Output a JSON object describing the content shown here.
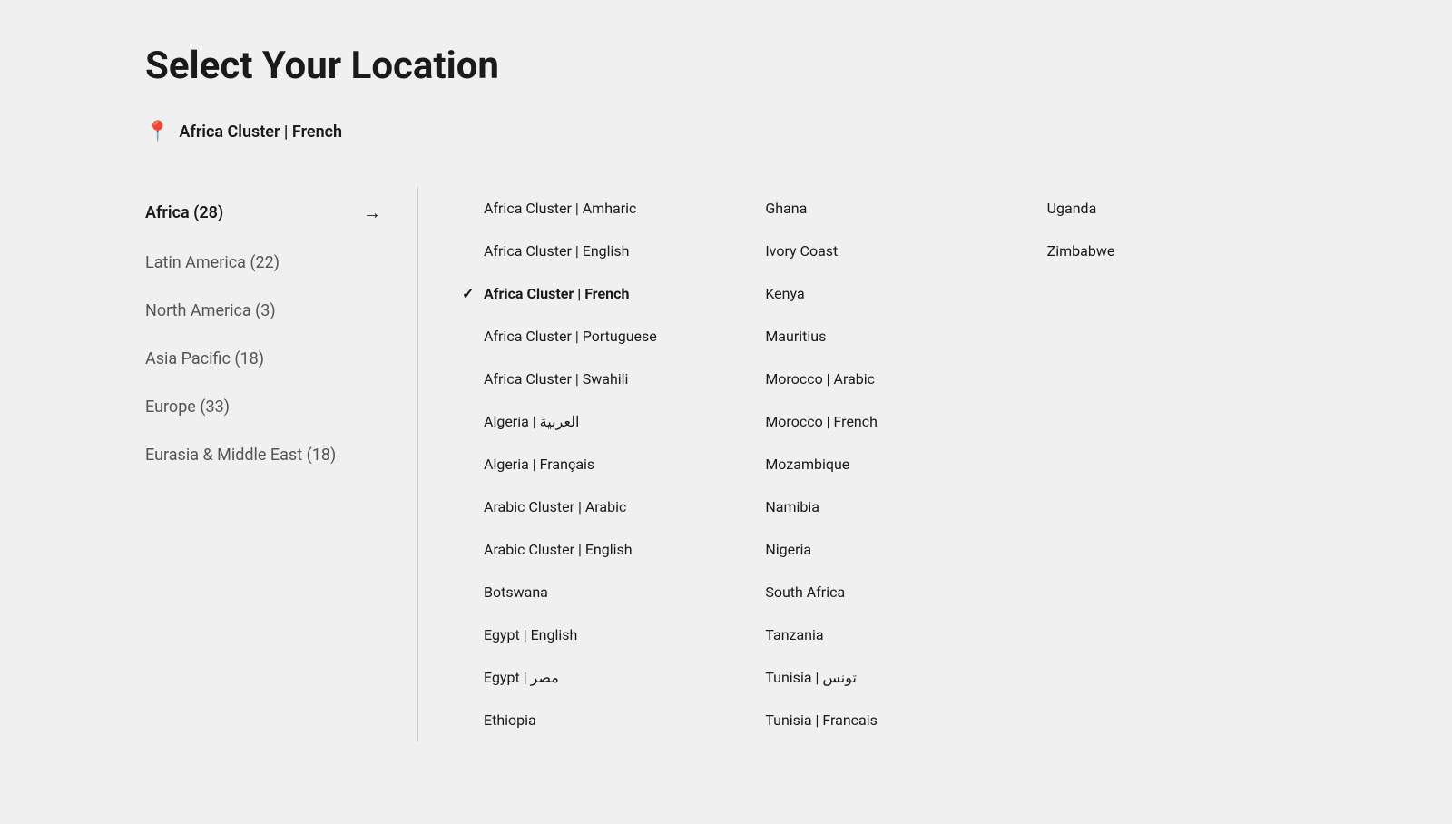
{
  "page": {
    "title": "Select Your Location",
    "current_location": "Africa Cluster | French",
    "location_icon": "📍"
  },
  "sidebar": {
    "items": [
      {
        "label": "Africa (28)",
        "active": true
      },
      {
        "label": "Latin America (22)",
        "active": false
      },
      {
        "label": "North America (3)",
        "active": false
      },
      {
        "label": "Asia Pacific (18)",
        "active": false
      },
      {
        "label": "Europe (33)",
        "active": false
      },
      {
        "label": "Eurasia & Middle East (18)",
        "active": false
      }
    ]
  },
  "locations": {
    "column1": [
      {
        "label": "Africa Cluster | Amharic",
        "selected": false
      },
      {
        "label": "Africa Cluster | English",
        "selected": false
      },
      {
        "label": "Africa Cluster | French",
        "selected": true
      },
      {
        "label": "Africa Cluster | Portuguese",
        "selected": false
      },
      {
        "label": "Africa Cluster | Swahili",
        "selected": false
      },
      {
        "label": "Algeria | العربية",
        "selected": false
      },
      {
        "label": "Algeria | Français",
        "selected": false
      },
      {
        "label": "Arabic Cluster | Arabic",
        "selected": false
      },
      {
        "label": "Arabic Cluster | English",
        "selected": false
      },
      {
        "label": "Botswana",
        "selected": false
      },
      {
        "label": "Egypt | English",
        "selected": false
      },
      {
        "label": "Egypt | مصر",
        "selected": false
      },
      {
        "label": "Ethiopia",
        "selected": false
      }
    ],
    "column2": [
      {
        "label": "Ghana",
        "selected": false
      },
      {
        "label": "Ivory Coast",
        "selected": false
      },
      {
        "label": "Kenya",
        "selected": false
      },
      {
        "label": "Mauritius",
        "selected": false
      },
      {
        "label": "Morocco | Arabic",
        "selected": false
      },
      {
        "label": "Morocco | French",
        "selected": false
      },
      {
        "label": "Mozambique",
        "selected": false
      },
      {
        "label": "Namibia",
        "selected": false
      },
      {
        "label": "Nigeria",
        "selected": false
      },
      {
        "label": "South Africa",
        "selected": false
      },
      {
        "label": "Tanzania",
        "selected": false
      },
      {
        "label": "Tunisia | تونس",
        "selected": false
      },
      {
        "label": "Tunisia | Francais",
        "selected": false
      }
    ],
    "column3": [
      {
        "label": "Uganda",
        "selected": false
      },
      {
        "label": "Zimbabwe",
        "selected": false
      }
    ]
  }
}
